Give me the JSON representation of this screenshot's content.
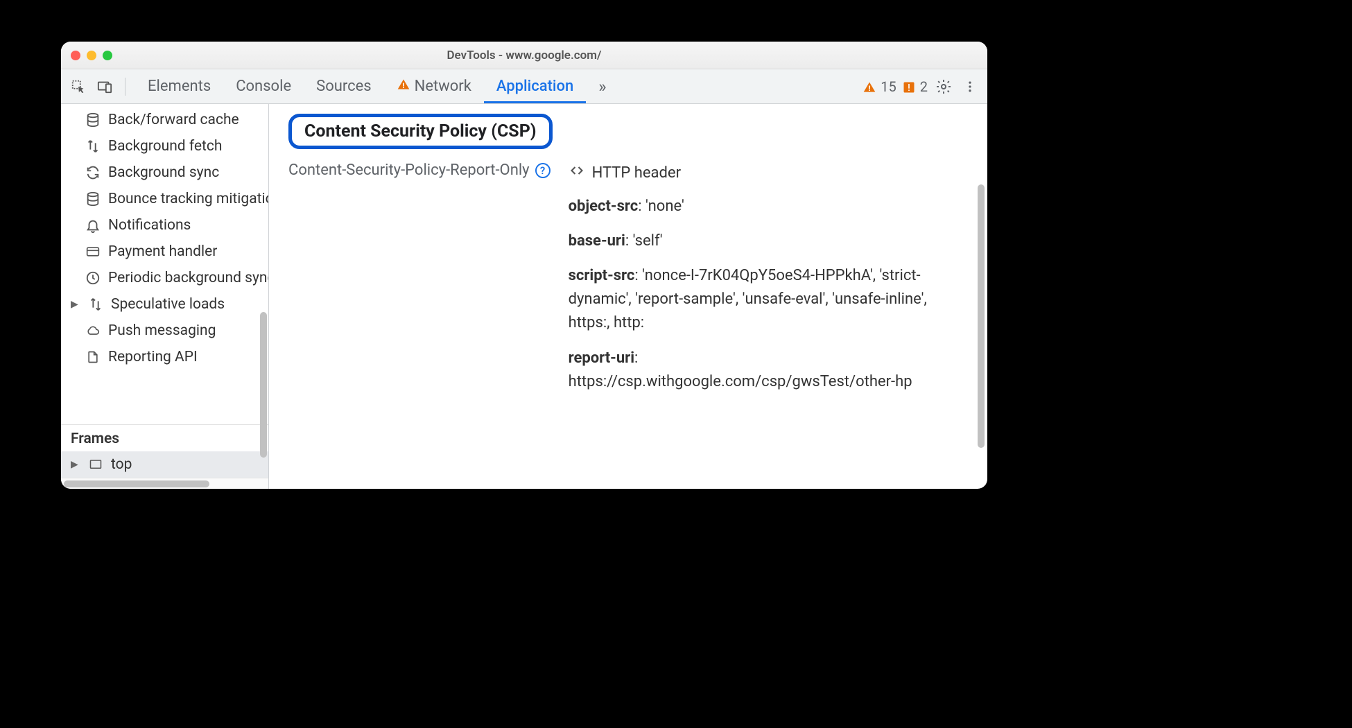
{
  "window": {
    "title": "DevTools - www.google.com/"
  },
  "toolbar": {
    "tabs": [
      "Elements",
      "Console",
      "Sources",
      "Network",
      "Application"
    ],
    "active_tab": "Application",
    "network_has_warning": true,
    "warnings_count": "15",
    "issues_count": "2"
  },
  "sidebar": {
    "items": [
      {
        "label": "Back/forward cache",
        "icon": "database"
      },
      {
        "label": "Background fetch",
        "icon": "updown"
      },
      {
        "label": "Background sync",
        "icon": "sync"
      },
      {
        "label": "Bounce tracking mitigations",
        "icon": "database"
      },
      {
        "label": "Notifications",
        "icon": "bell"
      },
      {
        "label": "Payment handler",
        "icon": "card"
      },
      {
        "label": "Periodic background sync",
        "icon": "clock"
      },
      {
        "label": "Speculative loads",
        "icon": "updown",
        "expandable": true
      },
      {
        "label": "Push messaging",
        "icon": "cloud"
      },
      {
        "label": "Reporting API",
        "icon": "file"
      }
    ],
    "frames_header": "Frames",
    "frames_item": "top"
  },
  "main": {
    "heading": "Content Security Policy (CSP)",
    "header_label": "Content-Security-Policy-Report-Only",
    "source": "HTTP header",
    "directives": [
      {
        "name": "object-src",
        "value": "'none'"
      },
      {
        "name": "base-uri",
        "value": "'self'"
      },
      {
        "name": "script-src",
        "value": "'nonce-I-7rK04QpY5oeS4-HPPkhA', 'strict-dynamic', 'report-sample', 'unsafe-eval', 'unsafe-inline', https:, http:"
      },
      {
        "name": "report-uri",
        "value": "https://csp.withgoogle.com/csp/gwsTest/other-hp"
      }
    ]
  }
}
